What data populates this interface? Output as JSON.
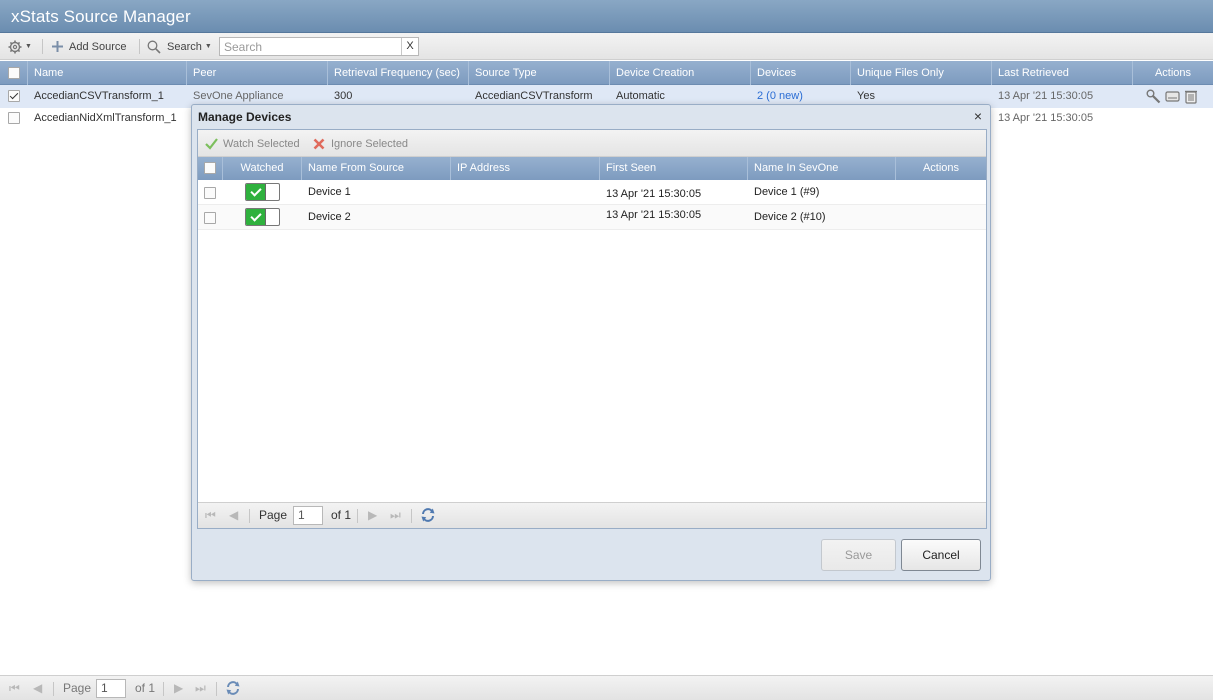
{
  "app": {
    "title": "xStats Source Manager"
  },
  "toolbar": {
    "add_source_label": "Add Source",
    "search_label": "Search",
    "search_placeholder": "Search",
    "clear_label": "X"
  },
  "grid": {
    "columns": [
      "Name",
      "Peer",
      "Retrieval Frequency (sec)",
      "Source Type",
      "Device Creation",
      "Devices",
      "Unique Files Only",
      "Last Retrieved",
      "Actions"
    ],
    "rows": [
      {
        "checked": true,
        "name": "AccedianCSVTransform_1",
        "peer": "SevOne Appliance",
        "frequency": "300",
        "source_type": "AccedianCSVTransform",
        "device_creation": "Automatic",
        "devices": "2 (0 new)",
        "unique_files_only": "Yes",
        "last_retrieved": "13 Apr '21 15:30:05"
      },
      {
        "checked": false,
        "name": "AccedianNidXmlTransform_1",
        "last_retrieved": "13 Apr '21 15:30:05"
      }
    ]
  },
  "pager": {
    "page_label": "Page",
    "page_value": "1",
    "of_label": "of 1"
  },
  "modal": {
    "title": "Manage Devices",
    "close_label": "×",
    "watch_selected_label": "Watch Selected",
    "ignore_selected_label": "Ignore Selected",
    "columns": [
      "Watched",
      "Name From Source",
      "IP Address",
      "First Seen",
      "Name In SevOne",
      "Actions"
    ],
    "rows": [
      {
        "watched": true,
        "name_from_source": "Device 1",
        "ip_address": "",
        "first_seen": "13 Apr '21 15:30:05",
        "name_in_sevone": "Device 1 (#9)"
      },
      {
        "watched": true,
        "name_from_source": "Device 2",
        "ip_address": "",
        "first_seen": "13 Apr '21 15:30:05",
        "name_in_sevone": "Device 2 (#10)"
      }
    ],
    "pager": {
      "page_label": "Page",
      "page_value": "1",
      "of_label": "of 1"
    },
    "save_label": "Save",
    "cancel_label": "Cancel"
  },
  "colors": {
    "header_blue": "#7d9bbf",
    "title_blue": "#6b8db0",
    "toggle_green": "#2fb13e",
    "link_blue": "#2a6dd4"
  }
}
